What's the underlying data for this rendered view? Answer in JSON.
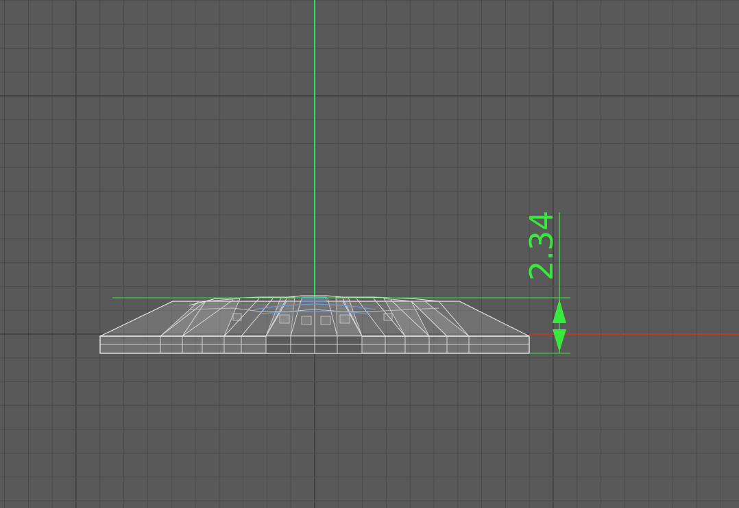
{
  "viewport": {
    "view_mode": "wireframe",
    "background_color": "#595959",
    "grid_color": "#4a4a4a",
    "grid_major_color": "#3c3c3c",
    "axis_x_color": "#b43a2e",
    "axis_y_color": "#2ee05a",
    "mesh_color": "#e6e6e6",
    "mesh_selected_color": "#6e9cd8"
  },
  "dimension": {
    "value_label": "2.34",
    "color": "#39e83c",
    "icon": "dimension-arrow-icon"
  }
}
